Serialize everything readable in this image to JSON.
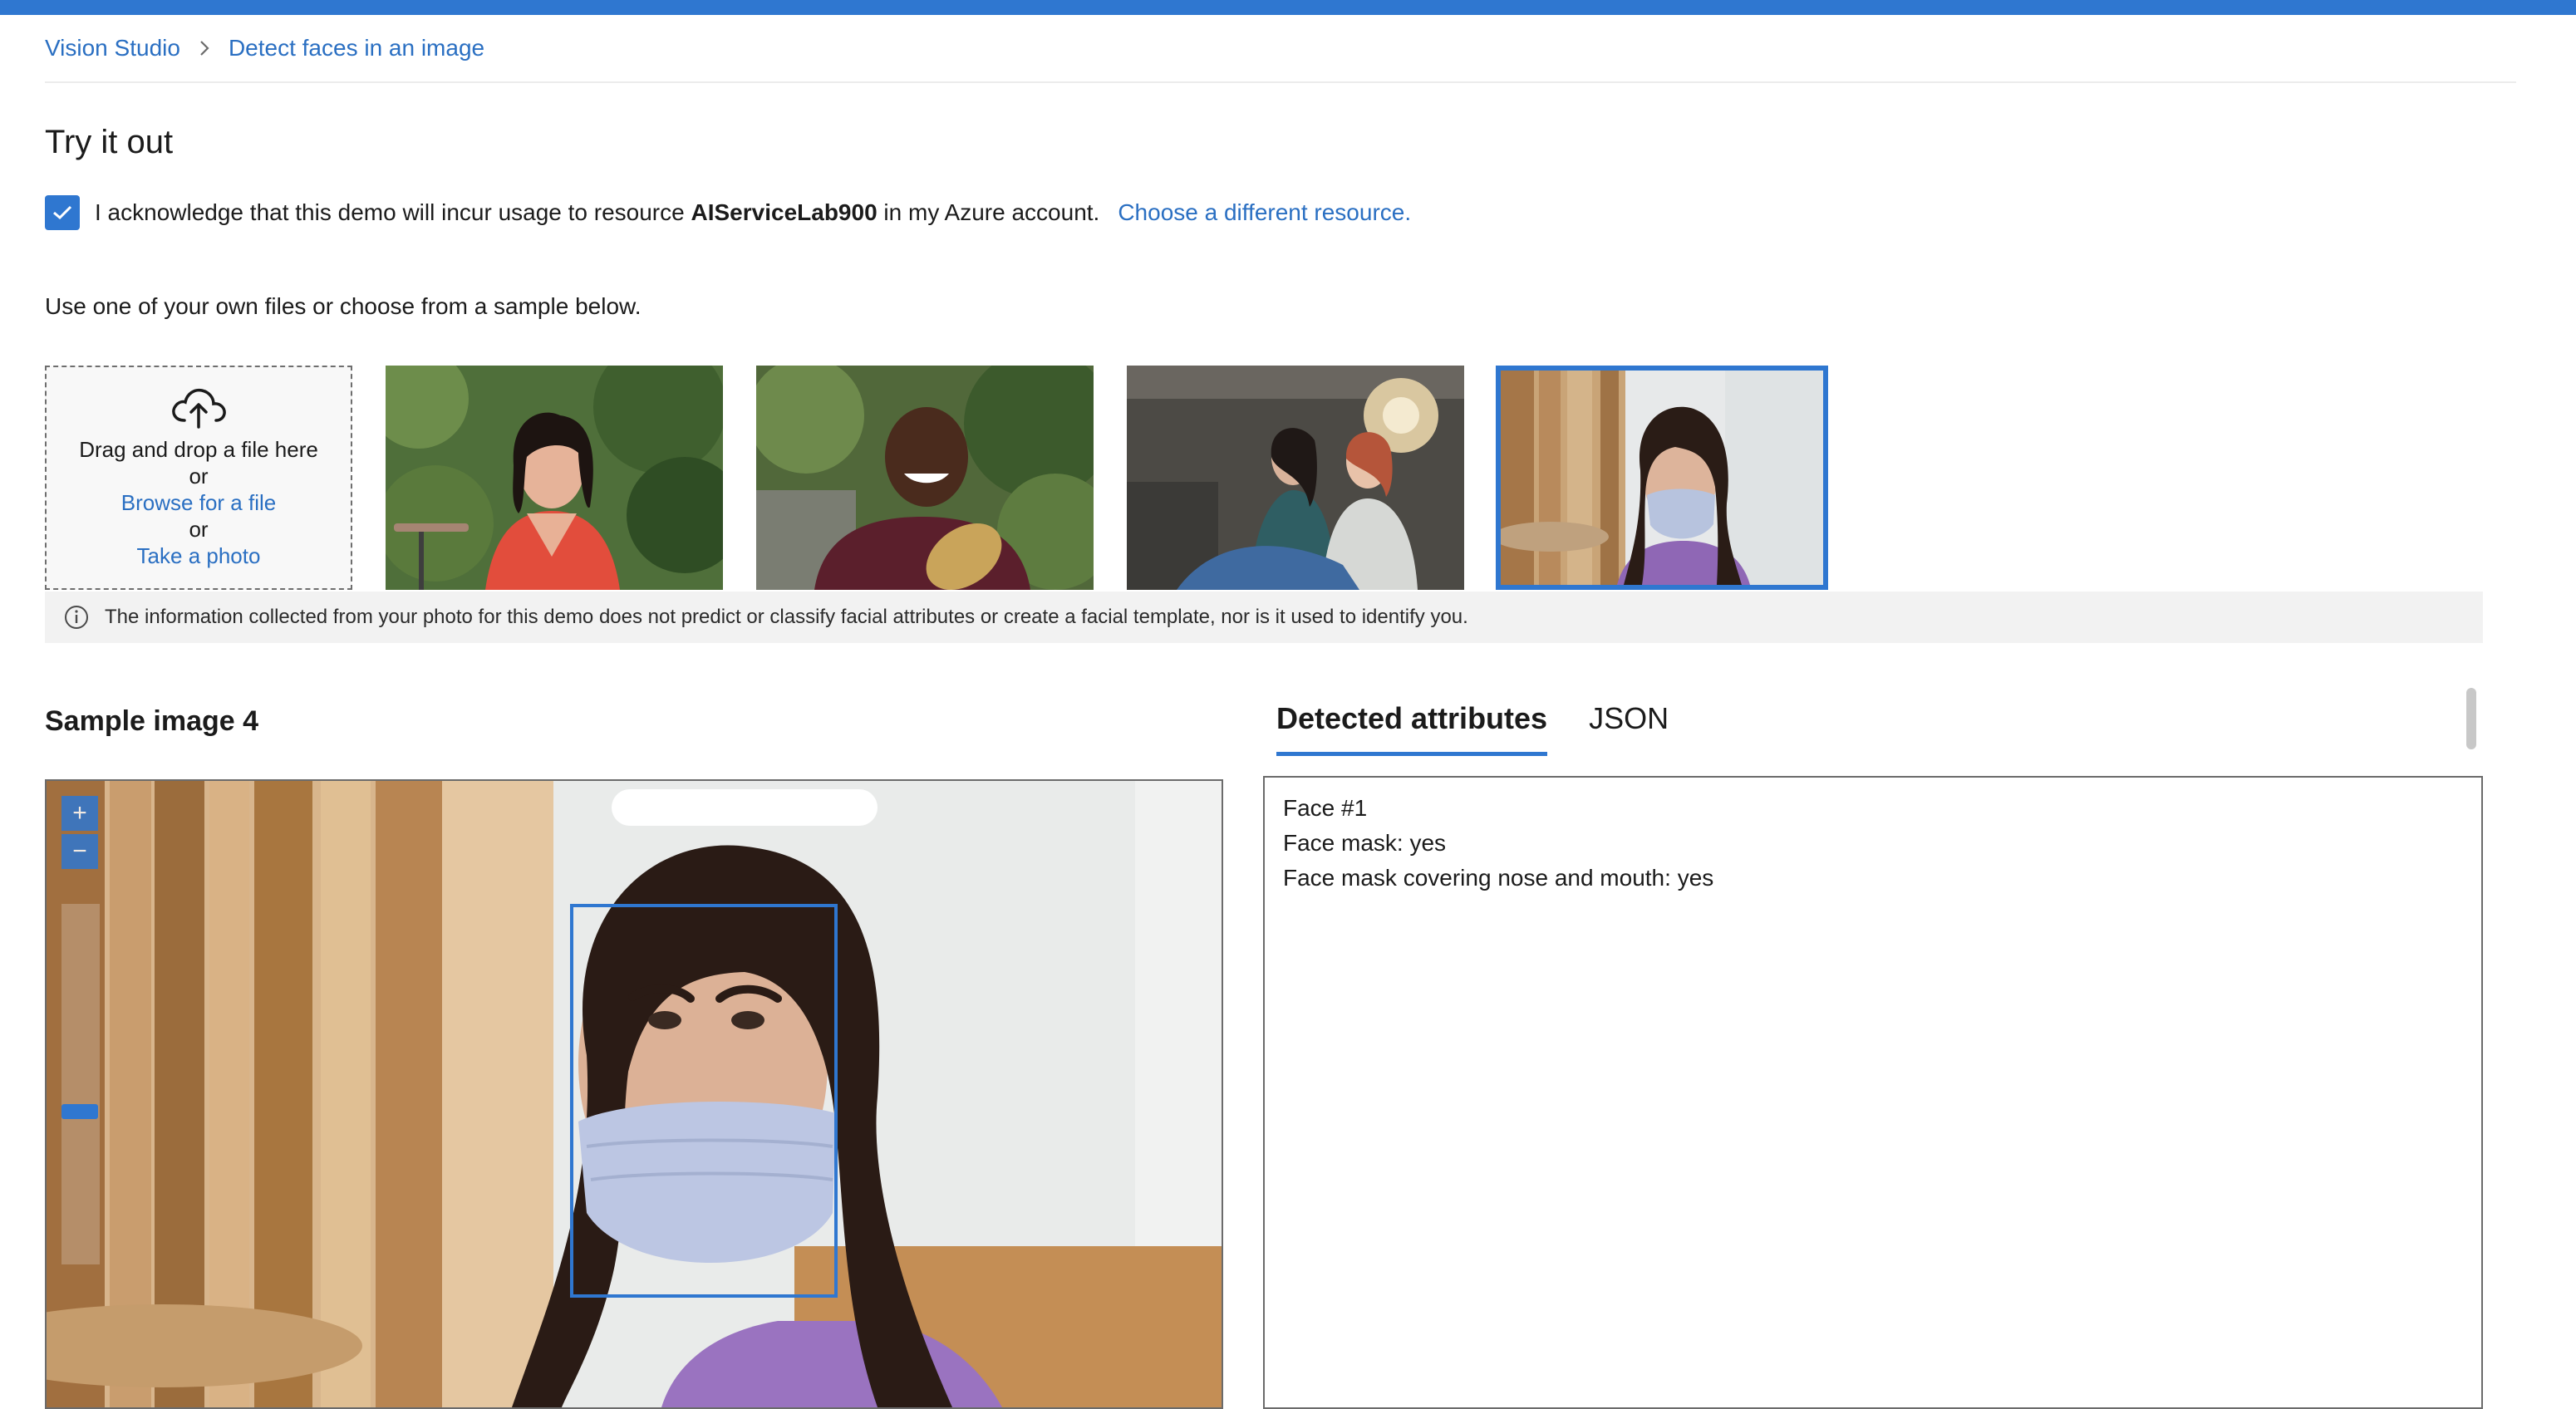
{
  "breadcrumb": {
    "items": [
      "Vision Studio",
      "Detect faces in an image"
    ]
  },
  "heading": "Try it out",
  "acknowledge": {
    "checked": true,
    "text_before": "I acknowledge that this demo will incur usage to resource ",
    "resource": "AIServiceLab900",
    "text_after": " in my Azure account.",
    "link": "Choose a different resource."
  },
  "upload": {
    "instruction": "Use one of your own files or choose from a sample below.",
    "drag_text": "Drag and drop a file here",
    "or1": "or",
    "browse": "Browse for a file",
    "or2": "or",
    "photo": "Take a photo"
  },
  "samples": {
    "selected_index": 4,
    "items": [
      "sample-1",
      "sample-2",
      "sample-3",
      "sample-4"
    ]
  },
  "info": "The information collected from your photo for this demo does not predict or classify facial attributes or create a facial template, nor is it used to identify you.",
  "preview": {
    "title": "Sample image 4",
    "zoom_in": "+",
    "zoom_out": "−",
    "zoom_level": 0.42
  },
  "tabs": [
    {
      "label": "Detected attributes",
      "active": true
    },
    {
      "label": "JSON",
      "active": false
    }
  ],
  "results": {
    "lines": [
      "Face #1",
      "Face mask: yes",
      "Face mask covering nose and mouth: yes"
    ]
  },
  "colors": {
    "accent": "#2f77d0",
    "link": "#2a6fc2"
  }
}
